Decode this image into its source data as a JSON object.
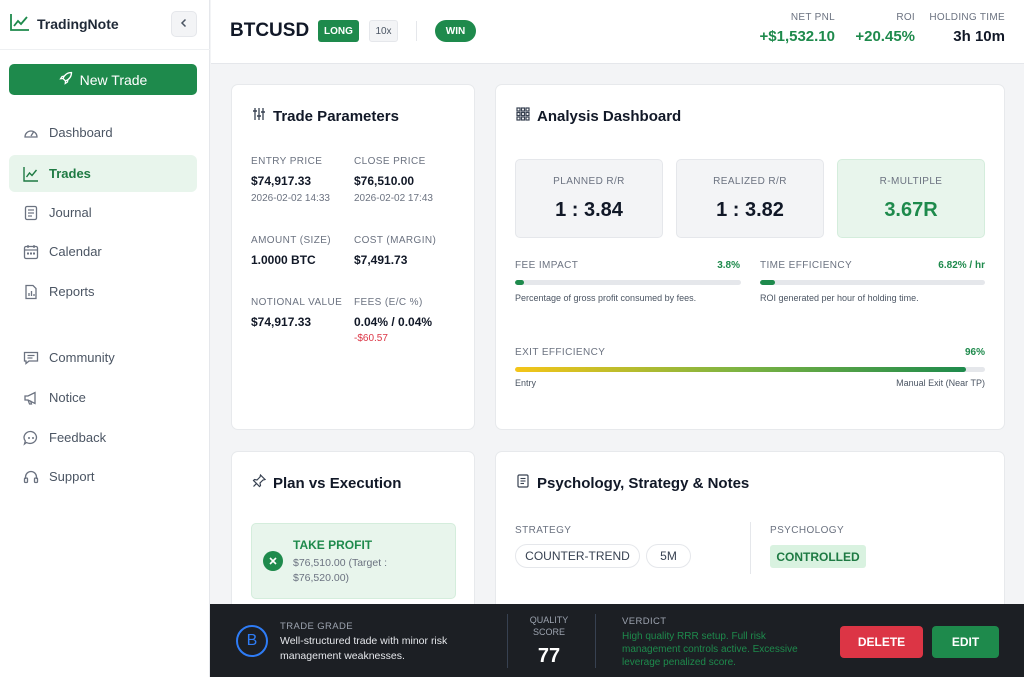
{
  "app": {
    "name": "TradingNote"
  },
  "sidebar": {
    "new_trade_label": "New Trade",
    "items": [
      {
        "label": "Dashboard",
        "icon": "gauge-icon"
      },
      {
        "label": "Trades",
        "icon": "chart-line-icon",
        "active": true
      },
      {
        "label": "Journal",
        "icon": "journal-icon"
      },
      {
        "label": "Calendar",
        "icon": "calendar-icon"
      },
      {
        "label": "Reports",
        "icon": "report-icon"
      },
      {
        "label": "Community",
        "icon": "chat-icon"
      },
      {
        "label": "Notice",
        "icon": "megaphone-icon"
      },
      {
        "label": "Feedback",
        "icon": "feedback-icon"
      },
      {
        "label": "Support",
        "icon": "headset-icon"
      }
    ]
  },
  "header": {
    "symbol": "BTCUSD",
    "side": "LONG",
    "leverage": "10x",
    "result": "WIN",
    "net_pnl_label": "NET PNL",
    "net_pnl": "+$1,532.10",
    "roi_label": "ROI",
    "roi": "+20.45%",
    "holding_label": "HOLDING TIME",
    "holding": "3h 10m"
  },
  "params": {
    "title": "Trade Parameters",
    "entry_label": "ENTRY PRICE",
    "entry_price": "$74,917.33",
    "entry_time": "2026-02-02 14:33",
    "close_label": "CLOSE PRICE",
    "close_price": "$76,510.00",
    "close_time": "2026-02-02 17:43",
    "amount_label": "AMOUNT (SIZE)",
    "amount": "1.0000 BTC",
    "cost_label": "COST (MARGIN)",
    "cost": "$7,491.73",
    "notional_label": "NOTIONAL VALUE",
    "notional": "$74,917.33",
    "fees_label": "FEES (E/C %)",
    "fees": "0.04% / 0.04%",
    "fees_amount": "-$60.57"
  },
  "analysis": {
    "title": "Analysis Dashboard",
    "planned_label": "PLANNED R/R",
    "planned": "1 : 3.84",
    "realized_label": "REALIZED R/R",
    "realized": "1 : 3.82",
    "rmult_label": "R-MULTIPLE",
    "rmult": "3.67R",
    "fee_label": "FEE IMPACT",
    "fee_value": "3.8%",
    "fee_fraction": 0.038,
    "fee_desc": "Percentage of gross profit consumed by fees.",
    "time_label": "TIME EFFICIENCY",
    "time_value": "6.82% / hr",
    "time_fraction": 0.068,
    "time_desc": "ROI generated per hour of holding time.",
    "exit_label": "EXIT EFFICIENCY",
    "exit_value": "96%",
    "exit_fraction": 0.96,
    "exit_left": "Entry",
    "exit_right": "Manual Exit (Near TP)"
  },
  "plan": {
    "title": "Plan vs Execution",
    "status": "TAKE PROFIT",
    "detail": "$76,510.00 (Target : $76,520.00)"
  },
  "psych": {
    "title": "Psychology, Strategy & Notes",
    "strategy_label": "STRATEGY",
    "strategy_tags": [
      "COUNTER-TREND",
      "5M"
    ],
    "psychology_label": "PSYCHOLOGY",
    "psychology_tag": "CONTROLLED"
  },
  "bottom": {
    "grade": "B",
    "grade_label": "TRADE GRADE",
    "grade_desc": "Well-structured trade with minor risk management weaknesses.",
    "score_label": "QUALITY SCORE",
    "score": "77",
    "verdict_label": "VERDICT",
    "verdict": "High quality RRR setup. Full risk management controls active. Excessive leverage penalized score.",
    "delete_label": "DELETE",
    "edit_label": "EDIT"
  },
  "colors": {
    "brand": "#1e8a4c",
    "danger": "#dc3545",
    "grade": "#2e7cf6",
    "bar_exit_start": "#f5c518"
  }
}
